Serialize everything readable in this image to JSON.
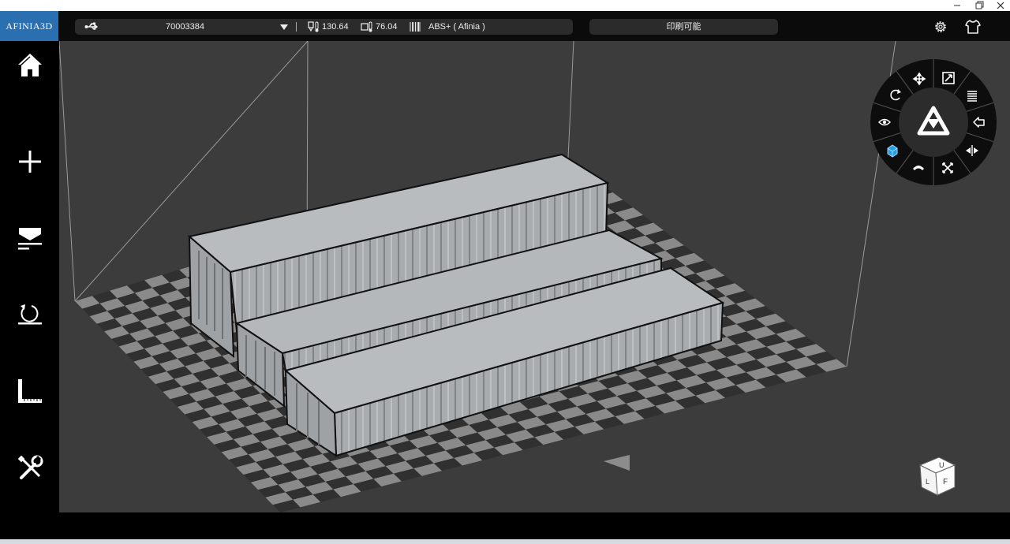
{
  "window": {
    "minimize_icon": "minimize-icon",
    "restore_icon": "restore-icon",
    "close_icon": "close-icon"
  },
  "toolbar": {
    "logo": "AFINIA3D",
    "connection_icon": "usb-icon",
    "printer_serial": "70003384",
    "dropdown_icon": "chevron-down-icon",
    "nozzle_temp": "130.64",
    "bed_temp": "76.04",
    "material": "ABS+ ( Afinia )",
    "print_status": "印刷可能",
    "settings_icon": "gear-icon",
    "account_icon": "shirt-icon"
  },
  "sidebar": {
    "items": [
      {
        "name": "home",
        "icon": "home-icon"
      },
      {
        "name": "add",
        "icon": "plus-icon"
      },
      {
        "name": "print",
        "icon": "print-icon"
      },
      {
        "name": "initialize",
        "icon": "reset-icon"
      },
      {
        "name": "calibrate",
        "icon": "ruler-icon"
      },
      {
        "name": "maintenance",
        "icon": "tools-icon"
      }
    ]
  },
  "radial_menu": {
    "center_icon": "afinia-logo-icon",
    "items": [
      "move",
      "scale",
      "layers",
      "undo",
      "mirror",
      "zoom-fit",
      "support",
      "part",
      "view",
      "rotate"
    ]
  },
  "view_cube": {
    "faces": [
      "U",
      "L",
      "F"
    ]
  },
  "colors": {
    "logo_bg": "#2a6fb0",
    "viewport_bg": "#3c3c3c",
    "model": "#a9adb0",
    "checker_dark": "#303030",
    "checker_light": "#8a8a8a"
  }
}
